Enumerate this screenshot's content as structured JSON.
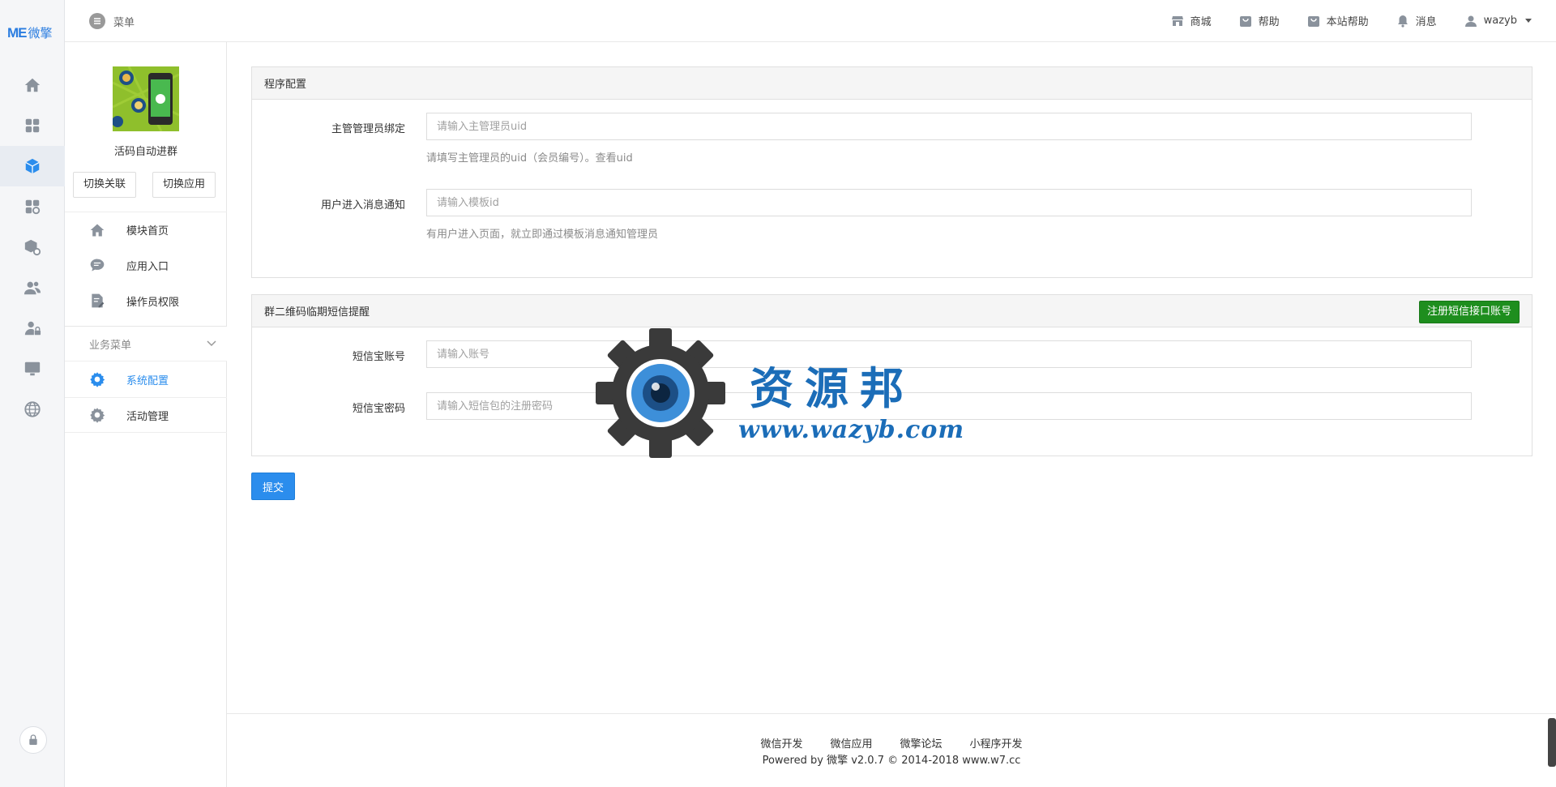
{
  "brand": {
    "logo_text": "ME",
    "logo_cn": "微擎",
    "accent": "#2b8ded",
    "green": "#1e8e1e"
  },
  "rail": {
    "items": [
      {
        "name": "home-icon"
      },
      {
        "name": "apps-grid-icon"
      },
      {
        "name": "cube-icon"
      },
      {
        "name": "modules-icon"
      },
      {
        "name": "box-settings-icon"
      },
      {
        "name": "users-icon"
      },
      {
        "name": "user-lock-icon"
      },
      {
        "name": "monitor-icon"
      },
      {
        "name": "globe-icon"
      }
    ],
    "active_index": 2
  },
  "topbar": {
    "menu_label": "菜单",
    "nav": [
      {
        "icon": "store-icon",
        "label": "商城"
      },
      {
        "icon": "bag-icon",
        "label": "帮助"
      },
      {
        "icon": "bag-icon",
        "label": "本站帮助"
      },
      {
        "icon": "bell-icon",
        "label": "消息"
      },
      {
        "icon": "user-icon",
        "label": "wazyb"
      }
    ]
  },
  "sidebar": {
    "app_name": "活码自动进群",
    "switch_link_label": "切换关联",
    "switch_app_label": "切换应用",
    "items": [
      {
        "icon": "home-icon",
        "label": "模块首页"
      },
      {
        "icon": "chat-icon",
        "label": "应用入口"
      },
      {
        "icon": "doc-edit-icon",
        "label": "操作员权限"
      }
    ],
    "group_label": "业务菜单",
    "group_items": [
      {
        "icon": "gear-icon",
        "label": "系统配置",
        "active": true
      },
      {
        "icon": "gear-icon",
        "label": "活动管理",
        "active": false
      }
    ]
  },
  "panel1": {
    "title": "程序配置",
    "fields": [
      {
        "label": "主管管理员绑定",
        "placeholder": "请输入主管理员uid",
        "help": "请填写主管理员的uid（会员编号）。查看uid"
      },
      {
        "label": "用户进入消息通知",
        "placeholder": "请输入模板id",
        "help": "有用户进入页面，就立即通过模板消息通知管理员"
      }
    ]
  },
  "panel2": {
    "title": "群二维码临期短信提醒",
    "register_button": "注册短信接口账号",
    "fields": [
      {
        "label": "短信宝账号",
        "placeholder": "请输入账号"
      },
      {
        "label": "短信宝密码",
        "placeholder": "请输入短信包的注册密码"
      }
    ]
  },
  "submit_label": "提交",
  "watermark": {
    "text": "资源邦",
    "url": "www.wazyb.com"
  },
  "footer": {
    "links": [
      "微信开发",
      "微信应用",
      "微擎论坛",
      "小程序开发"
    ],
    "copyright": "Powered by 微擎 v2.0.7 © 2014-2018 www.w7.cc"
  }
}
